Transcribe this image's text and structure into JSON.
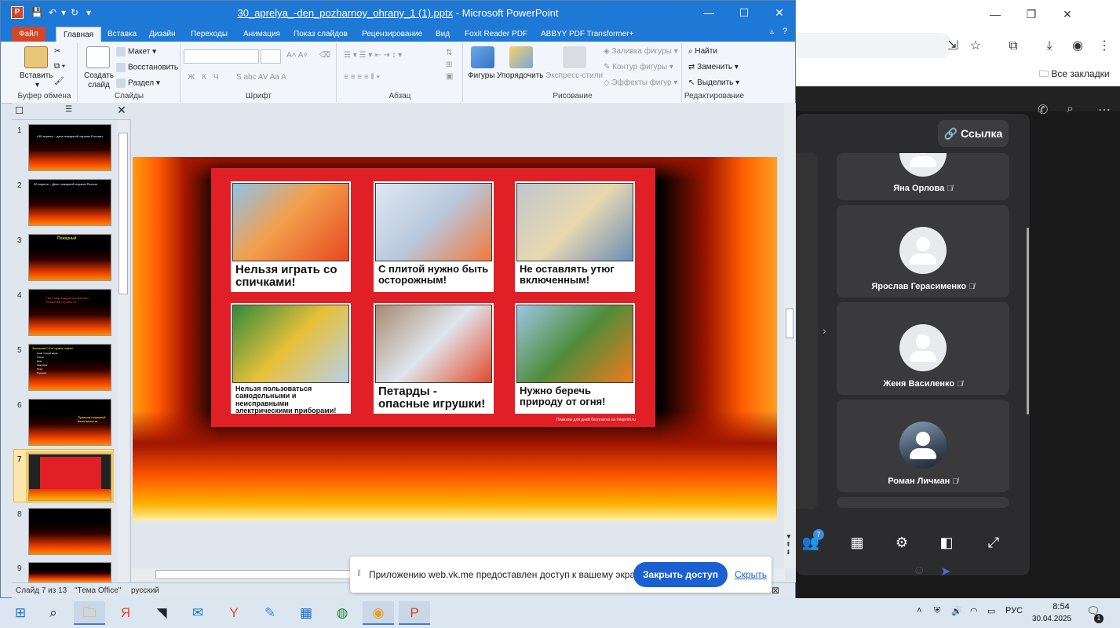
{
  "powerpoint": {
    "title_file": "30_aprelya_-den_pozharnoy_ohrany_1 (1).pptx",
    "title_app": " - Microsoft PowerPoint",
    "window_controls": [
      "—",
      "☐",
      "✕"
    ],
    "tabs": [
      "Файл",
      "Главная",
      "Вставка",
      "Дизайн",
      "Переходы",
      "Анимация",
      "Показ слайдов",
      "Рецензирование",
      "Вид",
      "Foxit Reader PDF",
      "ABBYY PDF Transformer+"
    ],
    "groups": {
      "clipboard": {
        "label": "Буфер обмена",
        "paste": "Вставить"
      },
      "slides": {
        "label": "Слайды",
        "new_slide": "Создать слайд",
        "layout": "Макет",
        "reset": "Восстановить",
        "section": "Раздел"
      },
      "font": {
        "label": "Шрифт"
      },
      "paragraph": {
        "label": "Абзац"
      },
      "drawing": {
        "label": "Рисование",
        "shapes": "Фигуры",
        "arrange": "Упорядочить",
        "quick_styles": "Экспресс-стили",
        "fill": "Заливка фигуры",
        "outline": "Контур фигуры",
        "effects": "Эффекты фигур"
      },
      "editing": {
        "label": "Редактирование",
        "find": "Найти",
        "replace": "Заменить",
        "select": "Выделить"
      }
    },
    "slide_numbers": [
      "1",
      "2",
      "3",
      "4",
      "5",
      "6",
      "7",
      "8",
      "9"
    ],
    "slide_thumb_titles": [
      "«30 апреля – день пожарной охраны России»",
      "30 апреля – День пожарной охраны России",
      "Пожарный",
      "Пять мер каждой профессии пожарной охраны 01",
      "Запомни!!! Что нужно знать!",
      "Правила пожарной безопасности",
      "",
      "",
      ""
    ],
    "slide_thumb_lists": {
      "5": [
        "Свой точный адрес",
        "Улица",
        "Дом",
        "Квартира",
        "Этаж",
        "Подъезд"
      ]
    },
    "current_slide": 7,
    "poster_cards": [
      {
        "caption": "Нельзя играть со спичками!"
      },
      {
        "caption": "С плитой нужно быть осторожным!"
      },
      {
        "caption": "Не оставлять утюг включенным!"
      },
      {
        "caption": "Нельзя пользоваться самодельными и неисправными электрическими приборами!"
      },
      {
        "caption": "Петарды - опасные игрушки!"
      },
      {
        "caption": "Нужно беречь природу от огня!"
      }
    ],
    "poster_credit": "Плакаты для дней бесплатно на freeprint.ru",
    "status": {
      "slide": "Слайд 7 из 13",
      "theme": "\"Тема Office\"",
      "lang": "русский"
    }
  },
  "chrome": {
    "bookmarks_label": "Все закладки",
    "window_controls": [
      "—",
      "❐",
      "✕"
    ]
  },
  "vk": {
    "link_button": "Ссылка",
    "participants": [
      {
        "name": "Яна Орлова"
      },
      {
        "name": "Ярослав Герасименко"
      },
      {
        "name": "Женя Василенко"
      },
      {
        "name": "Роман Личман"
      }
    ],
    "participants_badge": "7"
  },
  "share_banner": {
    "message": "Приложению web.vk.me предоставлен доступ к вашему экрану.",
    "stop": "Закрыть доступ",
    "hide": "Скрыть"
  },
  "taskbar": {
    "lang": "РУС",
    "time": "8:54",
    "date": "30.04.2025",
    "notifications": "1"
  },
  "colors": {
    "ppt_blue": "#1e78d6",
    "file_tab": "#d24726",
    "poster_red": "#e01f26",
    "vk_bg": "#19191a",
    "share_blue": "#1a60d0"
  }
}
